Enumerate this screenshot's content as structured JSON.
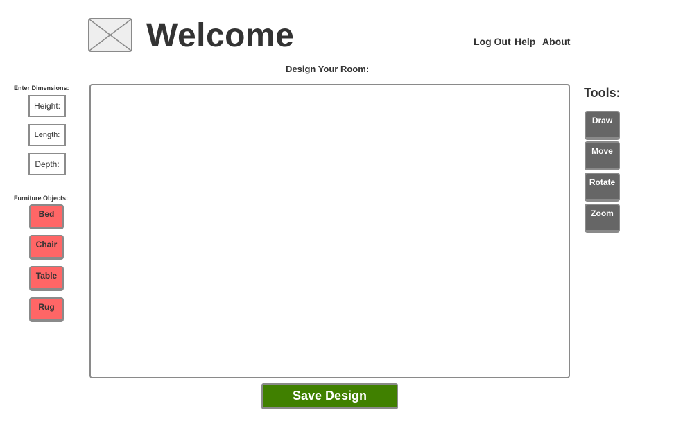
{
  "header": {
    "title": "Welcome",
    "logo_icon": "image-placeholder-icon",
    "nav": {
      "logout": "Log Out",
      "help": "Help",
      "about": "About"
    }
  },
  "main": {
    "design_label": "Design Your Room:",
    "save_label": "Save Design"
  },
  "left_panel": {
    "dimensions_title": "Enter Dimensions:",
    "height_placeholder": "Height:",
    "length_placeholder": "Length:",
    "depth_placeholder": "Depth:",
    "furniture_title": "Furniture Objects:",
    "furniture": {
      "bed": "Bed",
      "chair": "Chair",
      "table": "Table",
      "rug": "Rug"
    }
  },
  "tools": {
    "title": "Tools:",
    "draw": "Draw",
    "move": "Move",
    "rotate": "Rotate",
    "zoom": "Zoom"
  },
  "colors": {
    "furniture_button": "#ff6666",
    "tool_button": "#666666",
    "save_button": "#408000",
    "text": "#333333",
    "border": "#8a8a8a"
  }
}
